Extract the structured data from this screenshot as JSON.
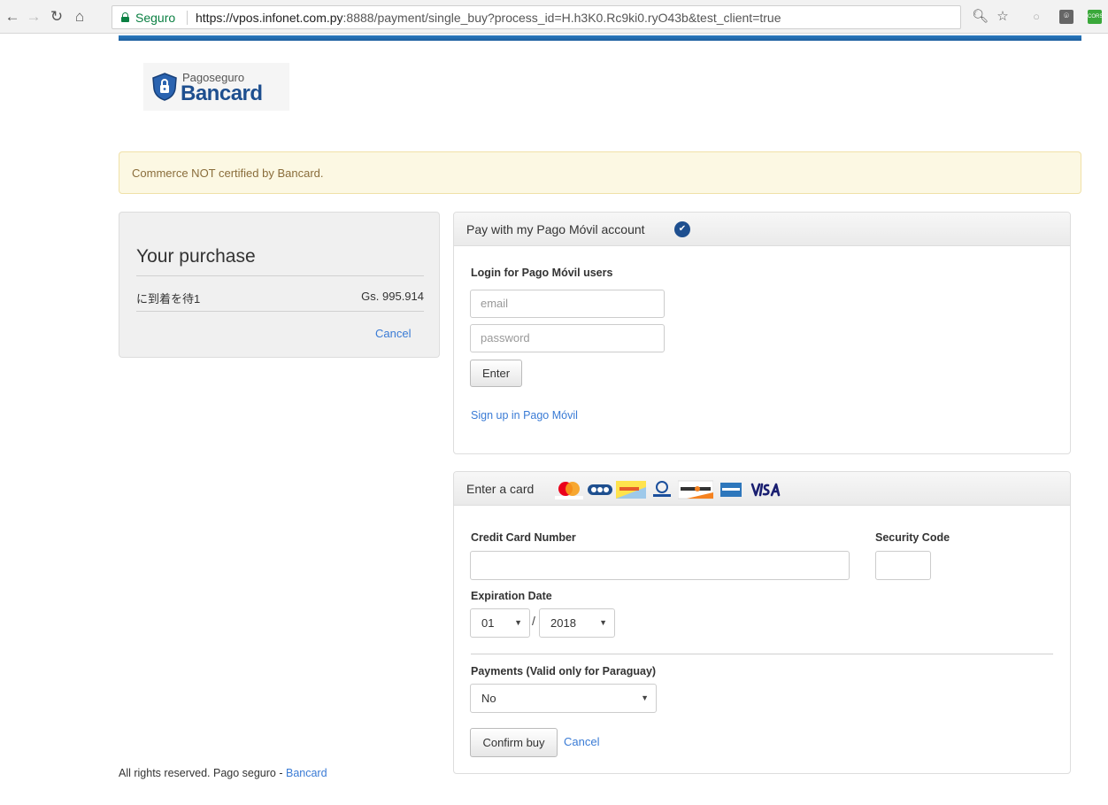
{
  "browser": {
    "secure_label": "Seguro",
    "url_host": "https://vpos.infonet.com.py",
    "url_rest": ":8888/payment/single_buy?process_id=H.h3K0.Rc9ki0.ryO43b&test_client=true",
    "ext_label": "CORS"
  },
  "logo": {
    "small": "Pagoseguro",
    "big": "Bancard"
  },
  "alert": {
    "text": "Commerce NOT certified by Bancard."
  },
  "purchase": {
    "title": "Your purchase",
    "item_name": "に到着を待1",
    "item_price": "Gs. 995.914",
    "cancel": "Cancel"
  },
  "pago_movil": {
    "title": "Pay with my Pago Móvil account",
    "login_label": "Login for Pago Móvil users",
    "email_placeholder": "email",
    "password_placeholder": "password",
    "enter_button": "Enter",
    "signup_link": "Sign up in Pago Móvil"
  },
  "card": {
    "title": "Enter a card",
    "brands": [
      "Mastercard",
      "Bancard",
      "Credifielco",
      "Diners Club",
      "Discover",
      "American Express",
      "VISA"
    ],
    "number_label": "Credit Card Number",
    "security_label": "Security Code",
    "expiration_label": "Expiration Date",
    "exp_month": "01",
    "exp_separator": "/",
    "exp_year": "2018",
    "payments_label": "Payments (Valid only for Paraguay)",
    "payments_value": "No",
    "confirm_button": "Confirm buy",
    "cancel": "Cancel"
  },
  "footer": {
    "text": "All rights reserved. Pago seguro - ",
    "link": "Bancard"
  },
  "colors": {
    "brand_blue": "#1e4f8f",
    "link": "#3a7bd5",
    "alert_bg": "#fcf8e3",
    "secure_green": "#0b8043"
  }
}
